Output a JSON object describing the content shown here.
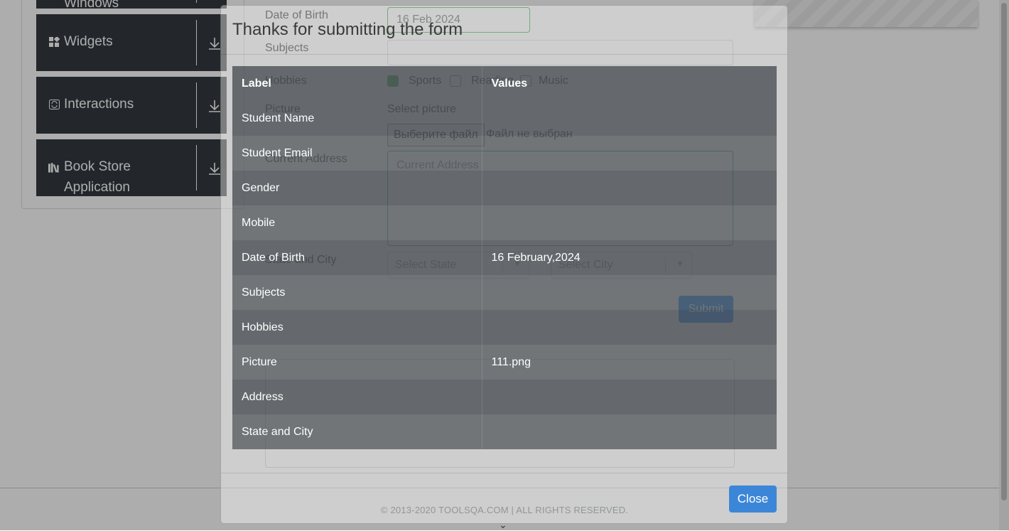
{
  "sidebar": {
    "groups": [
      {
        "label": "Windows",
        "icon": "window-icon"
      },
      {
        "label": "Widgets",
        "icon": "widgets-icon"
      },
      {
        "label": "Interactions",
        "icon": "interactions-icon"
      },
      {
        "label": "Book Store Application",
        "icon": "book-icon"
      }
    ]
  },
  "form": {
    "dob_label": "Date of Birth",
    "dob_value": "16 Feb 2024",
    "subjects_label": "Subjects",
    "hobbies_label": "Hobbies",
    "hobbies": [
      {
        "label": "Sports",
        "checked": true
      },
      {
        "label": "Reading",
        "checked": false
      },
      {
        "label": "Music",
        "checked": false
      }
    ],
    "picture_label": "Picture",
    "picture_select_text": "Select picture",
    "file_button": "Выберите файл",
    "file_status": "Файл не выбран",
    "address_label": "Current Address",
    "address_placeholder": "Current Address",
    "state_city_label": "State and City",
    "state_placeholder": "Select State",
    "city_placeholder": "Select City",
    "submit_label": "Submit"
  },
  "footer": {
    "copyright": "© 2013-2020 TOOLSQA.COM | ALL RIGHTS RESERVED."
  },
  "modal": {
    "title": "Thanks for submitting the form",
    "table": {
      "headers": [
        "Label",
        "Values"
      ],
      "rows": [
        [
          "Student Name",
          ""
        ],
        [
          "Student Email",
          ""
        ],
        [
          "Gender",
          ""
        ],
        [
          "Mobile",
          ""
        ],
        [
          "Date of Birth",
          "16 February,2024"
        ],
        [
          "Subjects",
          ""
        ],
        [
          "Hobbies",
          ""
        ],
        [
          "Picture",
          "111.png"
        ],
        [
          "Address",
          ""
        ],
        [
          "State and City",
          ""
        ]
      ]
    },
    "close_label": "Close"
  },
  "colors": {
    "sidebar_bg": "#343a40",
    "success": "#28a745",
    "primary": "#007bff"
  }
}
